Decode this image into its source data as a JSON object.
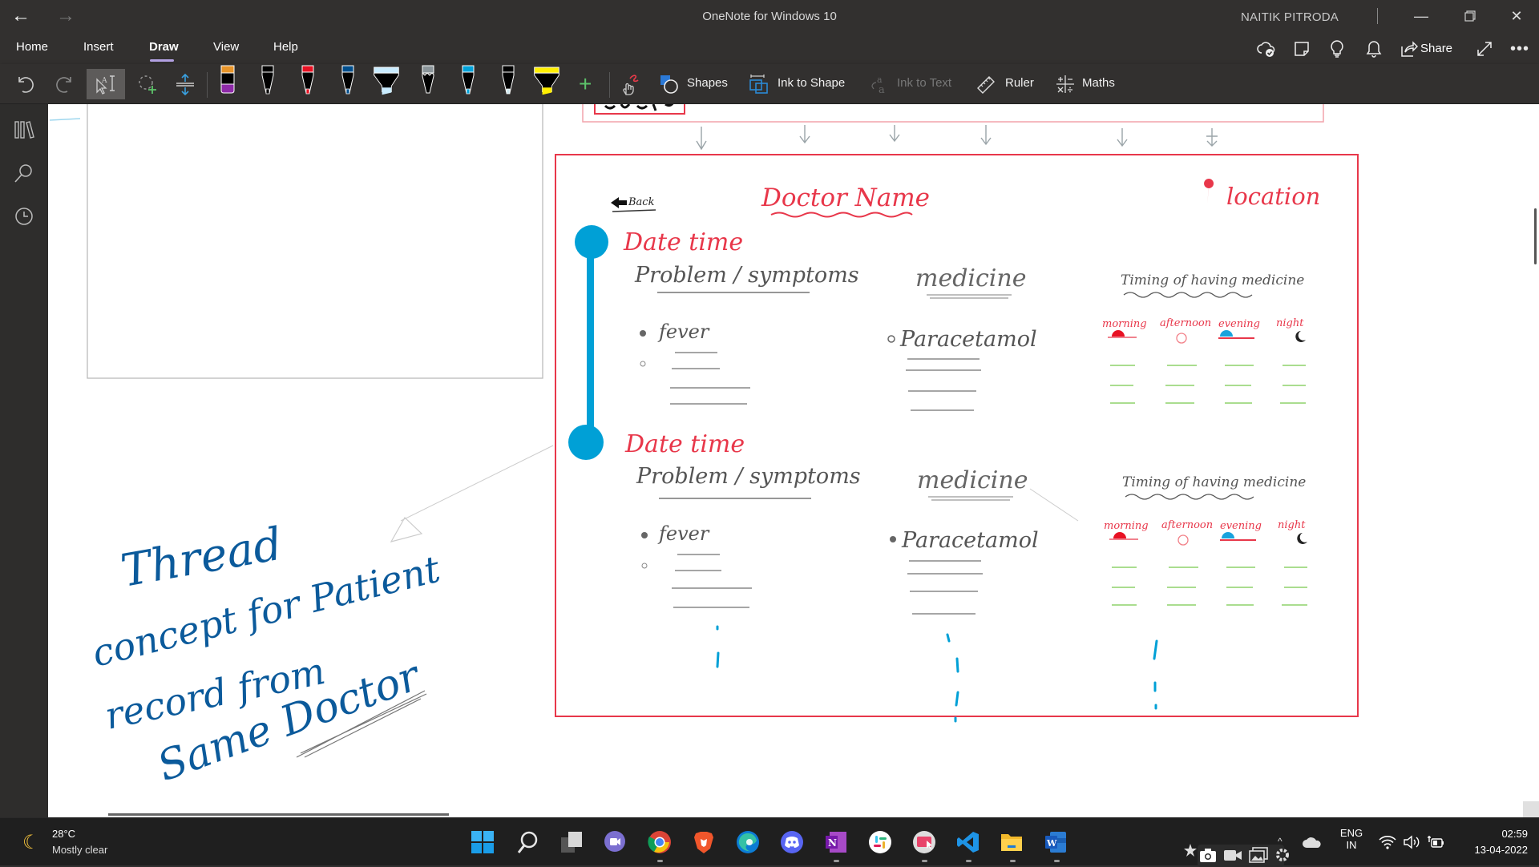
{
  "window": {
    "title": "OneNote for Windows 10",
    "user": "NAITIK PITRODA",
    "controls": [
      "minimize",
      "restore",
      "close"
    ]
  },
  "menu": {
    "tabs": [
      {
        "label": "Home",
        "active": false
      },
      {
        "label": "Insert",
        "active": false
      },
      {
        "label": "Draw",
        "active": true
      },
      {
        "label": "View",
        "active": false
      },
      {
        "label": "Help",
        "active": false
      }
    ],
    "right_actions": {
      "sync_icon": "cloud-check-icon",
      "sticky_notes_icon": "sticky-note-icon",
      "tell_me_icon": "lightbulb-icon",
      "notifications_icon": "bell-icon",
      "share_label": "Share",
      "fullscreen_icon": "expand-icon",
      "more_icon": "ellipsis-icon"
    }
  },
  "toolbar": {
    "tools": [
      "undo",
      "redo",
      "lasso-text-select",
      "lasso-select",
      "add-remove-space"
    ],
    "pens": [
      {
        "kind": "eraser",
        "color": "#e8952a",
        "body": "#8e2aa8"
      },
      {
        "kind": "pen",
        "color": "#000000"
      },
      {
        "kind": "pen",
        "color": "#e81123"
      },
      {
        "kind": "pen",
        "color": "#004e8c"
      },
      {
        "kind": "highlighter",
        "color": "#c9ecff"
      },
      {
        "kind": "pencil",
        "color": "#8a9499"
      },
      {
        "kind": "pen",
        "color": "#00a2d9"
      },
      {
        "kind": "pen",
        "color": "#000000"
      },
      {
        "kind": "highlighter",
        "color": "#ffef00"
      }
    ],
    "add_pen_label": "+",
    "buttons": [
      {
        "label": "Shapes",
        "enabled": true
      },
      {
        "label": "Ink to Shape",
        "enabled": true
      },
      {
        "label": "Ink to Text",
        "enabled": false
      },
      {
        "label": "Ruler",
        "enabled": true
      },
      {
        "label": "Maths",
        "enabled": true
      }
    ]
  },
  "sidebar": {
    "items": [
      {
        "icon": "notebooks-icon"
      },
      {
        "icon": "search-icon"
      },
      {
        "icon": "recent-icon"
      }
    ]
  },
  "canvas": {
    "sketch": {
      "back_label": "Back",
      "doctor_name": "Doctor Name",
      "location_label": "location",
      "entries": [
        {
          "date_time": "Date time",
          "problem_header": "Problem / symptoms",
          "problem_items": [
            "fever"
          ],
          "medicine_header": "medicine",
          "medicine_items": [
            "Paracetamol"
          ],
          "timing_header": "Timing of having medicine",
          "timing_slots": [
            "morning",
            "afternoon",
            "evening",
            "night"
          ]
        },
        {
          "date_time": "Date time",
          "problem_header": "Problem / symptoms",
          "problem_items": [
            "fever"
          ],
          "medicine_header": "medicine",
          "medicine_items": [
            "Paracetamol"
          ],
          "timing_header": "Timing of having medicine",
          "timing_slots": [
            "morning",
            "afternoon",
            "evening",
            "night"
          ]
        }
      ],
      "annotation_lines": [
        "Thread",
        "concept for Patient",
        "record from",
        "Same Doctor"
      ],
      "colors": {
        "frame": "#e8374a",
        "timeline": "#00a0d6",
        "annotation": "#0b5a9b",
        "placeholder": "#8ed26a"
      }
    }
  },
  "taskbar": {
    "weather": {
      "temp": "28°C",
      "desc": "Mostly clear"
    },
    "apps": [
      "start",
      "search",
      "task-view",
      "teams-chat",
      "chrome",
      "brave",
      "edge",
      "discord",
      "onenote",
      "slack",
      "screen-recorder",
      "vscode",
      "file-explorer",
      "word"
    ],
    "tray": {
      "lang_top": "ENG",
      "lang_bottom": "IN",
      "time": "02:59",
      "date": "13-04-2022"
    }
  }
}
